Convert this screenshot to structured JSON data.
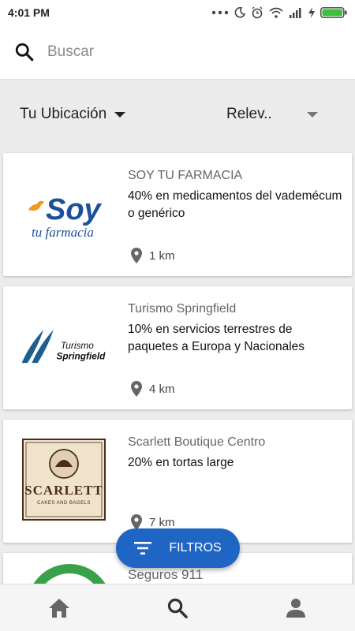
{
  "status_bar": {
    "time": "4:01 PM"
  },
  "search": {
    "placeholder": "Buscar"
  },
  "filters": {
    "location_label": "Tu Ubicación",
    "sort_label": "Relev.."
  },
  "cards": [
    {
      "logo_text": "Soy",
      "logo_sub": "tu farmacia",
      "title": "SOY TU FARMACIA",
      "description": "40% en medicamentos del vademécum o genérico",
      "distance": "1 km"
    },
    {
      "logo_text": "Turismo",
      "logo_sub": "Springfield",
      "title": "Turismo Springfield",
      "description": "10% en servicios terrestres de paquetes a Europa y Nacionales",
      "distance": "4 km"
    },
    {
      "logo_text": "SCARLETT",
      "logo_sub": "CAKES AND BAGELS",
      "title": "Scarlett Boutique Centro",
      "description": "20% en tortas large",
      "distance": "7 km"
    },
    {
      "title": "Seguros 911"
    }
  ],
  "fab": {
    "label": "FILTROS"
  },
  "colors": {
    "accent": "#1f66c4",
    "soy_orange": "#f29a1f",
    "soy_blue": "#1c4f9c",
    "springfield_blue": "#1b5e8f",
    "scarlett_brown": "#4a2d1c",
    "seguros_green": "#3aa14b"
  },
  "icons": [
    "search-icon",
    "caret-down-icon",
    "location-pin-icon",
    "filter-icon",
    "home-icon",
    "person-icon"
  ]
}
